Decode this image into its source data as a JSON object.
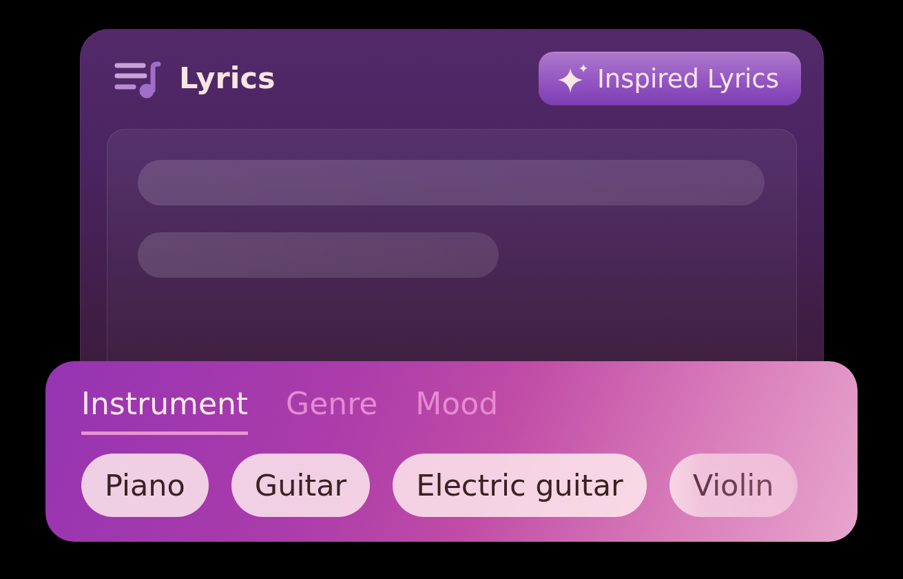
{
  "card": {
    "title": "Lyrics",
    "action_button": {
      "label": "Inspired Lyrics"
    },
    "lyrics_field": {
      "loading": true
    }
  },
  "panel": {
    "tabs": [
      {
        "label": "Instrument",
        "selected": true
      },
      {
        "label": "Genre",
        "selected": false
      },
      {
        "label": "Mood",
        "selected": false
      }
    ],
    "chips": [
      {
        "label": "Piano",
        "selected": false
      },
      {
        "label": "Guitar",
        "selected": false
      },
      {
        "label": "Electric guitar",
        "selected": false
      },
      {
        "label": "Violin",
        "selected": false
      }
    ]
  }
}
